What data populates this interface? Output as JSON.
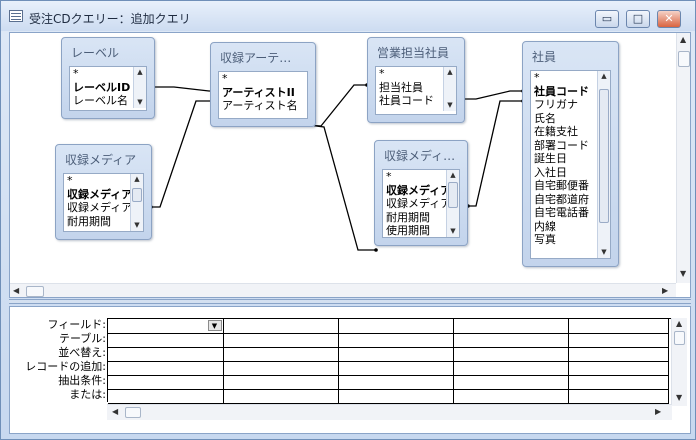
{
  "window": {
    "title": "受注CDクエリー：追加クエリ",
    "minimize_glyph": "▭",
    "maximize_glyph": "□",
    "close_glyph": "✕"
  },
  "tables": {
    "level": {
      "title": "レーベル",
      "fields": [
        {
          "label": "*",
          "key": false
        },
        {
          "label": "レーベルID",
          "key": true
        },
        {
          "label": "レーベル名",
          "key": false
        }
      ]
    },
    "media_left": {
      "title": "収録メディア",
      "fields": [
        {
          "label": "*",
          "key": false
        },
        {
          "label": "収録メディア",
          "key": true
        },
        {
          "label": "収録メディア",
          "key": false
        },
        {
          "label": "耐用期間",
          "key": false
        }
      ]
    },
    "artist": {
      "title": "収録アーテ…",
      "fields": [
        {
          "label": "*",
          "key": false
        },
        {
          "label": "アーティストII",
          "key": true
        },
        {
          "label": "アーティスト名",
          "key": false
        }
      ]
    },
    "sales": {
      "title": "営業担当社員",
      "fields": [
        {
          "label": "*",
          "key": false
        },
        {
          "label": "担当社員",
          "key": false
        },
        {
          "label": "社員コード",
          "key": false
        }
      ]
    },
    "media_right": {
      "title": "収録メディ…",
      "fields": [
        {
          "label": "*",
          "key": false
        },
        {
          "label": "収録メディア",
          "key": true
        },
        {
          "label": "収録メディア",
          "key": false
        },
        {
          "label": "耐用期間",
          "key": false
        },
        {
          "label": "使用期間",
          "key": false
        }
      ]
    },
    "employee": {
      "title": "社員",
      "fields": [
        {
          "label": "*",
          "key": false
        },
        {
          "label": "社員コード",
          "key": true
        },
        {
          "label": "フリガナ",
          "key": false
        },
        {
          "label": "氏名",
          "key": false
        },
        {
          "label": "在籍支社",
          "key": false
        },
        {
          "label": "部署コード",
          "key": false
        },
        {
          "label": "誕生日",
          "key": false
        },
        {
          "label": "入社日",
          "key": false
        },
        {
          "label": "自宅郵便番",
          "key": false
        },
        {
          "label": "自宅都道府",
          "key": false
        },
        {
          "label": "自宅電話番",
          "key": false
        },
        {
          "label": "内線",
          "key": false
        },
        {
          "label": "写真",
          "key": false
        }
      ]
    }
  },
  "grid": {
    "row_labels": [
      "フィールド:",
      "テーブル:",
      "並べ替え:",
      "レコードの追加:",
      "抽出条件:",
      "または:"
    ],
    "column_count": 5,
    "scroll_up_glyph": "▲",
    "scroll_down_glyph": "▼",
    "scroll_left_glyph": "◀",
    "scroll_right_glyph": "▶"
  },
  "colors": {
    "title_bg": "#dfe9f7",
    "table_header": "#c3d4ec",
    "close_button": "#d9633f",
    "join_line": "#000000"
  }
}
